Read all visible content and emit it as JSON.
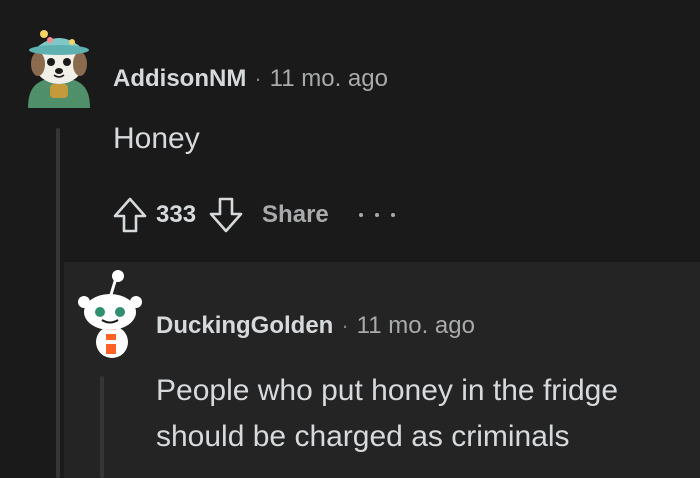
{
  "comments": [
    {
      "author": "AddisonNM",
      "separator": "·",
      "time": "11 mo. ago",
      "body": "Honey",
      "score": "333",
      "share_label": "Share",
      "avatar": "snoo-dog-avatar-icon"
    },
    {
      "author": "DuckingGolden",
      "separator": "·",
      "time": "11 mo. ago",
      "body": "People who put honey in the fridge should be charged as criminals",
      "avatar": "snoo-default-avatar-icon"
    }
  ],
  "icons": {
    "upvote": "upvote-arrow-icon",
    "downvote": "downvote-arrow-icon",
    "more": "more-options-icon"
  },
  "colors": {
    "background": "#1a1a1b",
    "reply_background": "#242425",
    "text": "#d7dadc",
    "meta": "#a8aaab",
    "thread_line": "#343536"
  }
}
